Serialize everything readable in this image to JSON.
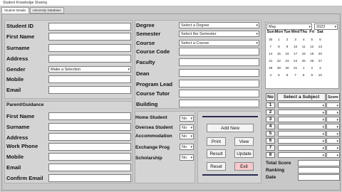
{
  "window": {
    "title": "Student Knowledge Sharing"
  },
  "tabs": [
    {
      "label": "Student Details"
    },
    {
      "label": "University Database"
    }
  ],
  "student": {
    "fields": [
      {
        "label": "Student ID"
      },
      {
        "label": "First Name"
      },
      {
        "label": "Surname"
      },
      {
        "label": "Address"
      },
      {
        "label": "Gender",
        "value": "Make a Selection"
      },
      {
        "label": "Mobile"
      },
      {
        "label": "Email"
      }
    ]
  },
  "parent": {
    "heading": "Parent/Guidance",
    "fields": [
      {
        "label": "First Name"
      },
      {
        "label": "Surname"
      },
      {
        "label": "Address"
      },
      {
        "label": "Work Phone"
      },
      {
        "label": "Mobile"
      },
      {
        "label": "Email"
      },
      {
        "label": "Confirm Email"
      }
    ]
  },
  "course": {
    "fields": [
      {
        "label": "Degree",
        "value": "Select a Degree"
      },
      {
        "label": "Semester",
        "value": "Select the Semester"
      },
      {
        "label": "Course",
        "value": "Select a Course"
      },
      {
        "label": "Course Code"
      },
      {
        "label": "Faculty"
      },
      {
        "label": "Dean"
      },
      {
        "label": "Program Lead"
      },
      {
        "label": "Course Tutor"
      },
      {
        "label": "Building"
      }
    ]
  },
  "options": [
    {
      "label": "Home Student",
      "value": "No"
    },
    {
      "label": "Oversea Student",
      "value": "No"
    },
    {
      "label": "Accommodation",
      "value": "No"
    },
    {
      "label": "Exchange Prog",
      "value": "No"
    },
    {
      "label": "Scholarship",
      "value": "No"
    }
  ],
  "buttons": {
    "add_new": "Add New",
    "print": "Print",
    "view": "View",
    "result": "Result",
    "update": "Update",
    "reset": "Reset",
    "exit": "Exit"
  },
  "calendar": {
    "month": "May",
    "year": "2023",
    "days": [
      "Sun",
      "Mon",
      "Tue",
      "Wed",
      "Thu",
      "Fri",
      "Sat"
    ],
    "weeks": [
      [
        "30",
        "1",
        "2",
        "3",
        "4",
        "5",
        "6"
      ],
      [
        "7",
        "8",
        "9",
        "10",
        "11",
        "12",
        "13"
      ],
      [
        "14",
        "15",
        "16",
        "17",
        "18",
        "19",
        "20"
      ],
      [
        "21",
        "22",
        "23",
        "24",
        "25",
        "26",
        "27"
      ],
      [
        "28",
        "29",
        "30",
        "31",
        "1",
        "2",
        "3"
      ],
      [
        "4",
        "5",
        "6",
        "7",
        "8",
        "9",
        "10"
      ]
    ]
  },
  "subjects": {
    "no_header": "No",
    "subject_header": "Select a Subject",
    "score_header": "Score",
    "rows": [
      "1",
      "2",
      "3",
      "4",
      "5",
      "6",
      "7",
      "8"
    ]
  },
  "totals": {
    "total_score": "Total Score",
    "ranking": "Ranking",
    "date": "Date"
  },
  "colors": {
    "exit_button": "#f7c9cc",
    "divider": "#2a2a50"
  }
}
